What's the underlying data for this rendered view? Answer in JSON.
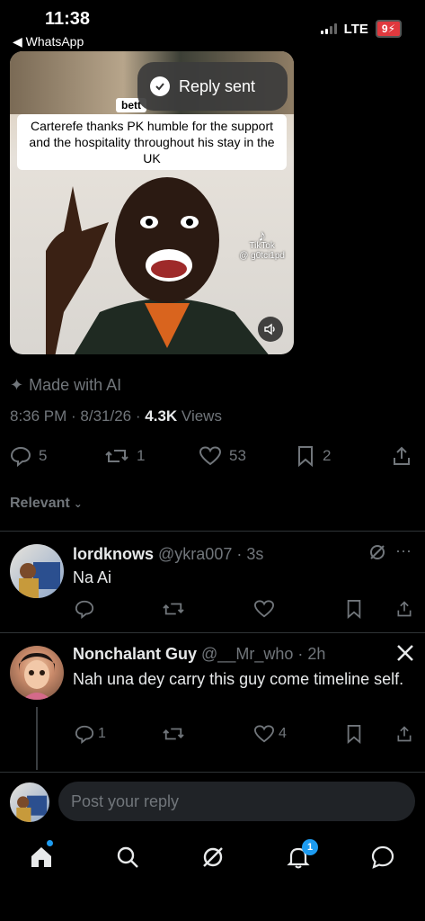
{
  "status_bar": {
    "time": "11:38",
    "back_label": "◀ WhatsApp",
    "network": "LTE",
    "battery": "9"
  },
  "media": {
    "partial_text": "bett",
    "caption": "Carterefe thanks PK humble for the support and the hospitality throughout his stay in the UK",
    "watermark_brand": "TikTok",
    "watermark_handle": "@ g0tci1pd"
  },
  "toast": {
    "label": "Reply sent"
  },
  "post": {
    "made_with_ai": "Made with AI",
    "time": "8:36 PM",
    "date": "8/31/26",
    "views_count": "4.3K",
    "views_label": "Views",
    "replies": "5",
    "reposts": "1",
    "likes": "53",
    "bookmarks": "2"
  },
  "sort": {
    "label": "Relevant"
  },
  "replies": [
    {
      "name": "lordknows",
      "handle": "@ykra007",
      "time": "3s",
      "text": "Na Ai",
      "replies": "",
      "reposts": "",
      "likes": ""
    },
    {
      "name": "Nonchalant Guy",
      "handle": "@__Mr_who",
      "time": "2h",
      "text": "Nah una dey carry this guy come timeline self.",
      "replies": "1",
      "reposts": "",
      "likes": "4"
    }
  ],
  "composer": {
    "placeholder": "Post your reply"
  },
  "tabbar": {
    "notifications_badge": "1"
  },
  "colors": {
    "accent": "#1d9bf0",
    "muted": "#71767b",
    "text": "#e7e9ea",
    "background": "#000000"
  }
}
